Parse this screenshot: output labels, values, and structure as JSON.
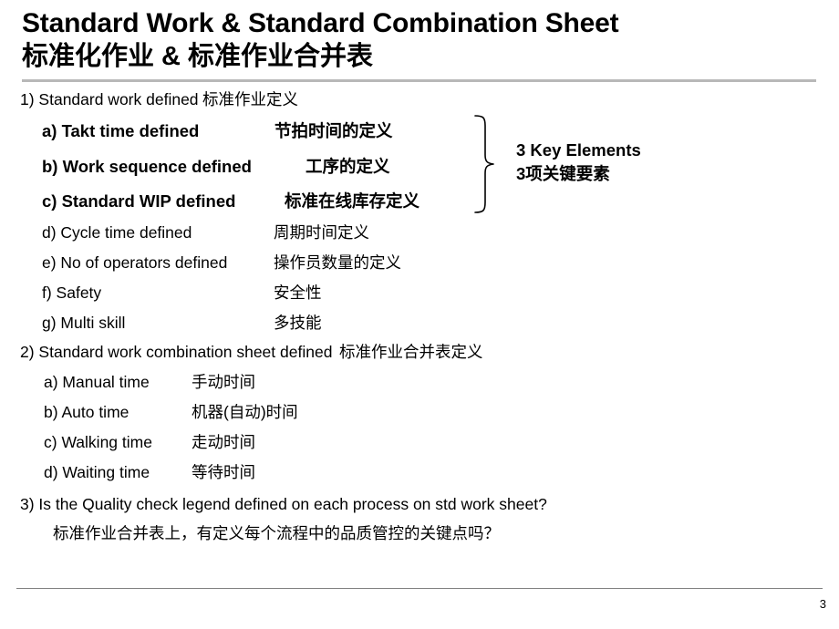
{
  "slide": {
    "title_en": "Standard Work & Standard Combination Sheet",
    "title_zh": "标准化作业 & 标准作业合并表",
    "page_number": "3"
  },
  "sections": [
    {
      "heading_en": "1) Standard work defined",
      "heading_zh": "标准作业定义",
      "items": [
        {
          "en": "a) Takt time defined",
          "zh": "节拍时间的定义",
          "bold": true
        },
        {
          "en": "b) Work sequence defined",
          "zh": "工序的定义",
          "bold": true
        },
        {
          "en": "c) Standard WIP defined",
          "zh": "标准在线库存定义",
          "bold": true
        },
        {
          "en": "d) Cycle time defined",
          "zh": "周期时间定义",
          "bold": false
        },
        {
          "en": "e) No of operators defined",
          "zh": "操作员数量的定义",
          "bold": false
        },
        {
          "en": "f) Safety",
          "zh": "安全性",
          "bold": false
        },
        {
          "en": "g) Multi skill",
          "zh": "多技能",
          "bold": false
        }
      ]
    },
    {
      "heading_en": "2) Standard work combination sheet defined",
      "heading_zh": "标准作业合并表定义",
      "items": [
        {
          "en": "a) Manual time",
          "zh": "手动时间",
          "bold": false
        },
        {
          "en": "b) Auto time",
          "zh": "机器(自动)时间",
          "bold": false
        },
        {
          "en": "c) Walking time",
          "zh": "走动时间",
          "bold": false
        },
        {
          "en": "d) Waiting time",
          "zh": "等待时间",
          "bold": false
        }
      ]
    },
    {
      "heading_en": "3) Is the Quality check legend defined on each process on std work sheet?",
      "heading_zh": "标准作业合并表上，有定义每个流程中的品质管控的关键点吗？",
      "items": []
    }
  ],
  "annotation": {
    "brace_label_en": "3 Key Elements",
    "brace_label_zh": "3项关键要素"
  }
}
